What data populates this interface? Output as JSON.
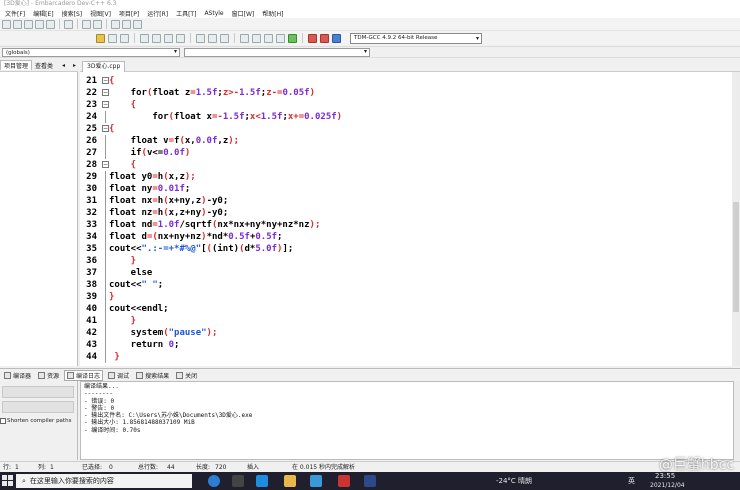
{
  "window": {
    "title": "[3D爱心] - Embarcadero Dev-C++ 6.3"
  },
  "menu": [
    "文件[F]",
    "编辑[E]",
    "搜索[S]",
    "视图[V]",
    "项目[P]",
    "运行[R]",
    "工具[T]",
    "AStyle",
    "窗口[W]",
    "帮助[H]"
  ],
  "toolbar": {
    "compiler": "TDM-GCC 4.9.2 64-bit Release"
  },
  "scope": {
    "value": "(globals)"
  },
  "left_tabs": [
    "项目管理",
    "查看类"
  ],
  "editor_tab": "3D爱心.cpp",
  "code_lines": [
    {
      "n": "21",
      "fold": "⊟",
      "segs": [
        {
          "t": "{",
          "c": "pn"
        }
      ]
    },
    {
      "n": "22",
      "fold": "⊟",
      "segs": [
        {
          "t": "    for"
        },
        {
          "t": "(",
          "c": "pn"
        },
        {
          "t": "float z"
        },
        {
          "t": "=",
          "c": "pn"
        },
        {
          "t": "1.5f",
          "c": "num"
        },
        {
          "t": ";"
        },
        {
          "t": "z>-",
          "c": "pn"
        },
        {
          "t": "1.5f",
          "c": "num"
        },
        {
          "t": ";"
        },
        {
          "t": "z-=",
          "c": "pn"
        },
        {
          "t": "0.05f",
          "c": "num"
        },
        {
          "t": ")",
          "c": "pn"
        }
      ]
    },
    {
      "n": "23",
      "fold": "⊟",
      "segs": [
        {
          "t": "    {",
          "c": "pn"
        }
      ]
    },
    {
      "n": "24",
      "fold": "",
      "segs": [
        {
          "t": "        for"
        },
        {
          "t": "(",
          "c": "pn"
        },
        {
          "t": "float x"
        },
        {
          "t": "=-",
          "c": "pn"
        },
        {
          "t": "1.5f",
          "c": "num"
        },
        {
          "t": ";"
        },
        {
          "t": "x<",
          "c": "pn"
        },
        {
          "t": "1.5f",
          "c": "num"
        },
        {
          "t": ";"
        },
        {
          "t": "x+=",
          "c": "pn"
        },
        {
          "t": "0.025f",
          "c": "num"
        },
        {
          "t": ")",
          "c": "pn"
        }
      ]
    },
    {
      "n": "25",
      "fold": "⊟",
      "segs": [
        {
          "t": "{",
          "c": "pn"
        }
      ]
    },
    {
      "n": "26",
      "fold": "",
      "segs": [
        {
          "t": "    float v"
        },
        {
          "t": "=",
          "c": "pn"
        },
        {
          "t": "f"
        },
        {
          "t": "(",
          "c": "pn"
        },
        {
          "t": "x,"
        },
        {
          "t": "0.0f",
          "c": "num"
        },
        {
          "t": ",z"
        },
        {
          "t": ");",
          "c": "pn"
        }
      ]
    },
    {
      "n": "27",
      "fold": "",
      "segs": [
        {
          "t": "    if"
        },
        {
          "t": "(",
          "c": "pn"
        },
        {
          "t": "v<="
        },
        {
          "t": "0.0f",
          "c": "num"
        },
        {
          "t": ")",
          "c": "pn"
        }
      ]
    },
    {
      "n": "28",
      "fold": "⊟",
      "segs": [
        {
          "t": "    {",
          "c": "pn"
        }
      ]
    },
    {
      "n": "29",
      "fold": "",
      "segs": [
        {
          "t": "float y0"
        },
        {
          "t": "=",
          "c": "pn"
        },
        {
          "t": "h"
        },
        {
          "t": "(",
          "c": "pn"
        },
        {
          "t": "x,z"
        },
        {
          "t": ");",
          "c": "pn"
        }
      ]
    },
    {
      "n": "30",
      "fold": "",
      "segs": [
        {
          "t": "float ny"
        },
        {
          "t": "=",
          "c": "pn"
        },
        {
          "t": "0.01f",
          "c": "num"
        },
        {
          "t": ";"
        }
      ]
    },
    {
      "n": "31",
      "fold": "",
      "segs": [
        {
          "t": "float nx"
        },
        {
          "t": "=",
          "c": "pn"
        },
        {
          "t": "h"
        },
        {
          "t": "(",
          "c": "pn"
        },
        {
          "t": "x+ny,z"
        },
        {
          "t": ")",
          "c": "pn"
        },
        {
          "t": "-y0;"
        }
      ]
    },
    {
      "n": "32",
      "fold": "",
      "segs": [
        {
          "t": "float nz"
        },
        {
          "t": "=",
          "c": "pn"
        },
        {
          "t": "h"
        },
        {
          "t": "(",
          "c": "pn"
        },
        {
          "t": "x,z+ny"
        },
        {
          "t": ")",
          "c": "pn"
        },
        {
          "t": "-y0;"
        }
      ]
    },
    {
      "n": "33",
      "fold": "",
      "segs": [
        {
          "t": "float nd"
        },
        {
          "t": "=",
          "c": "pn"
        },
        {
          "t": "1.0f",
          "c": "num"
        },
        {
          "t": "/sqrtf"
        },
        {
          "t": "(",
          "c": "pn"
        },
        {
          "t": "nx*nx+ny*ny+nz*nz"
        },
        {
          "t": ");",
          "c": "pn"
        }
      ]
    },
    {
      "n": "34",
      "fold": "",
      "segs": [
        {
          "t": "float d"
        },
        {
          "t": "=(",
          "c": "pn"
        },
        {
          "t": "nx+ny+nz"
        },
        {
          "t": ")",
          "c": "pn"
        },
        {
          "t": "*nd*"
        },
        {
          "t": "0.5f",
          "c": "num"
        },
        {
          "t": "+"
        },
        {
          "t": "0.5f",
          "c": "num"
        },
        {
          "t": ";"
        }
      ]
    },
    {
      "n": "35",
      "fold": "",
      "segs": [
        {
          "t": "cout<<"
        },
        {
          "t": "\".:-=+*#%@\"",
          "c": "str"
        },
        {
          "t": "["
        },
        {
          "t": "(",
          "c": "pn"
        },
        {
          "t": "(int)"
        },
        {
          "t": "(",
          "c": "pn"
        },
        {
          "t": "d*"
        },
        {
          "t": "5.0f",
          "c": "num"
        },
        {
          "t": ")",
          "c": "pn"
        },
        {
          "t": "];"
        }
      ]
    },
    {
      "n": "36",
      "fold": "",
      "segs": [
        {
          "t": "    }",
          "c": "pn"
        }
      ]
    },
    {
      "n": "37",
      "fold": "",
      "segs": [
        {
          "t": "    else"
        }
      ]
    },
    {
      "n": "38",
      "fold": "",
      "segs": [
        {
          "t": "cout<<"
        },
        {
          "t": "\" \"",
          "c": "str"
        },
        {
          "t": ";"
        }
      ]
    },
    {
      "n": "39",
      "fold": "",
      "segs": [
        {
          "t": "}",
          "c": "pn"
        }
      ]
    },
    {
      "n": "40",
      "fold": "",
      "segs": [
        {
          "t": "cout<<endl;"
        }
      ]
    },
    {
      "n": "41",
      "fold": "",
      "segs": [
        {
          "t": "    }",
          "c": "pn"
        }
      ]
    },
    {
      "n": "42",
      "fold": "",
      "segs": [
        {
          "t": "    system"
        },
        {
          "t": "(",
          "c": "pn"
        },
        {
          "t": "\"pause\"",
          "c": "str"
        },
        {
          "t": ");",
          "c": "pn"
        }
      ]
    },
    {
      "n": "43",
      "fold": "",
      "segs": [
        {
          "t": "    return "
        },
        {
          "t": "0",
          "c": "num"
        },
        {
          "t": ";"
        }
      ]
    },
    {
      "n": "44",
      "fold": "",
      "segs": [
        {
          "t": " }",
          "c": "pn"
        }
      ]
    }
  ],
  "bottom_tabs": [
    "编译器",
    "资源",
    "编译日志",
    "调试",
    "搜索结果",
    "关闭"
  ],
  "bottom_left": {
    "shorten_label": "Shorten compiler paths"
  },
  "compile_log": [
    "编译结果...",
    "--------",
    "- 错误: 0",
    "- 警告: 0",
    "- 输出文件名: C:\\Users\\苏小姝\\Documents\\3D爱心.exe",
    "- 输出大小: 1.85681488037109 MiB",
    "- 编译时间: 0.70s"
  ],
  "status": {
    "row_label": "行:",
    "row": "1",
    "col_label": "列:",
    "col": "1",
    "sel_label": "已选择:",
    "sel": "0",
    "total_label": "总行数:",
    "total": "44",
    "len_label": "长度:",
    "len": "720",
    "mode": "插入",
    "parse": "在 0.015 秒内完成解析"
  },
  "taskbar": {
    "search_placeholder": "在这里输入你要搜索的内容",
    "weather": "-24°C 晴朗",
    "lang": "英",
    "time": "23:55",
    "date": "2021/12/04"
  },
  "watermark": "@巨蟹hbcc",
  "colors": {
    "punct": "#e0282a",
    "number": "#7a2ad8",
    "string": "#1a58d8"
  }
}
